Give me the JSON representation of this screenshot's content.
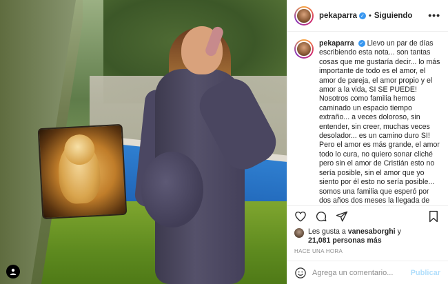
{
  "post": {
    "username": "pekaparra",
    "follow_status": "Siguiendo",
    "separator": "•",
    "caption_text": "Llevo un par de días escribiendo esta nota... son tantas cosas que me gustaría decir... lo más importante de todo es el amor, el amor de pareja, el amor propio y el amor a la vida, SI SE PUEDE! Nosotros como familia hemos caminado un espacio tiempo extraño... a veces doloroso, sin entender, sin creer, muchas veces desolador... es un camino duro SI! Pero el amor es más grande, el amor todo lo cura, no quiero sonar cliché pero sin el amor de Cristián esto no sería posible, sin el amor que yo siento por él esto no sería posible... somos una familia que esperó por dos años dos meses la llegada de otro integrante y como todos ya",
    "likes_prefix": "Les gusta a",
    "liked_by": "vanesaborghi",
    "likes_connector": "y",
    "likes_count": "21,081 personas más",
    "timestamp": "HACE UNA HORA"
  },
  "comment": {
    "placeholder": "Agrega un comentario...",
    "publish_label": "Publicar"
  },
  "icons": {
    "verified": "verified-badge-icon",
    "more": "more-options-icon",
    "like": "heart-icon",
    "comment": "comment-bubble-icon",
    "share": "paper-plane-icon",
    "save": "bookmark-icon",
    "emoji": "smiley-icon",
    "tag": "user-tag-icon"
  },
  "colors": {
    "verified": "#3897f0",
    "publish_disabled": "#b2dffc",
    "muted_text": "#8e8e8e"
  }
}
